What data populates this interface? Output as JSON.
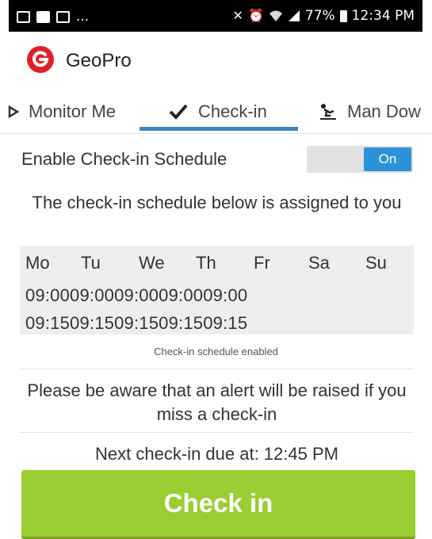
{
  "status_bar": {
    "left_text": "...",
    "battery": "77%",
    "time": "12:34 PM",
    "icons": [
      "image-icon",
      "sim-icon",
      "mail-icon",
      "mute-icon",
      "alarm-icon",
      "wifi-icon",
      "signal-icon",
      "battery-icon"
    ]
  },
  "app": {
    "title": "GeoPro",
    "logo_icon": "geopro-logo-icon",
    "brand_color": "#e0202d"
  },
  "tabs": [
    {
      "label": "Monitor Me",
      "icon": "monitor-me-icon",
      "active": false
    },
    {
      "label": "Check-in",
      "icon": "checkmark-icon",
      "active": true
    },
    {
      "label": "Man Dow",
      "icon": "man-down-icon",
      "active": false
    }
  ],
  "enable_schedule": {
    "label": "Enable Check-in Schedule",
    "toggle_value": "On",
    "toggle_color": "#2c93d6"
  },
  "assigned_text": "The check-in schedule below is assigned to you",
  "schedule": {
    "days": [
      "Mo",
      "Tu",
      "We",
      "Th",
      "Fr",
      "Sa",
      "Su"
    ],
    "times_row_1": "09:0009:0009:0009:0009:00",
    "times_row_2": "09:1509:1509:1509:1509:15"
  },
  "schedule_status": "Check-in schedule enabled",
  "warning_text": "Please be aware that an alert will be raised if you miss a check-in",
  "next_due": "Next check-in due at: 12:45 PM",
  "check_in_button": {
    "label": "Check in",
    "color": "#9acd32"
  },
  "accent_color": "#3b86c2"
}
